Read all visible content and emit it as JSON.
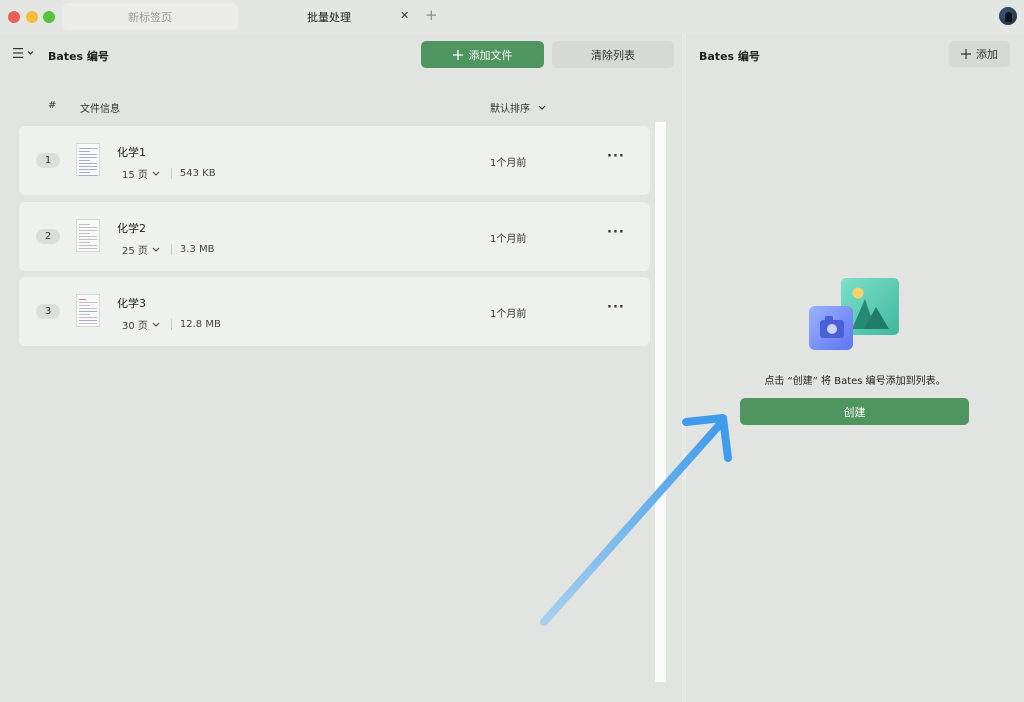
{
  "window": {
    "tabs": [
      {
        "label": "新标签页",
        "active": false
      },
      {
        "label": "批量处理",
        "active": true
      }
    ],
    "close_symbol": "✕",
    "new_tab_symbol": "+"
  },
  "left": {
    "title": "Bates 编号",
    "add_file_label": "添加文件",
    "clear_list_label": "清除列表",
    "columns": {
      "num": "#",
      "info": "文件信息",
      "sort": "默认排序"
    },
    "files": [
      {
        "index": "1",
        "name": "化学1",
        "pages": "15 页",
        "size": "543 KB",
        "date": "1个月前"
      },
      {
        "index": "2",
        "name": "化学2",
        "pages": "25 页",
        "size": "3.3 MB",
        "date": "1个月前"
      },
      {
        "index": "3",
        "name": "化学3",
        "pages": "30 页",
        "size": "12.8 MB",
        "date": "1个月前"
      }
    ],
    "more_symbol": "···"
  },
  "right": {
    "title": "Bates 编号",
    "add_label": "添加",
    "hint": "点击 “创建” 将 Bates 编号添加到列表。",
    "create_label": "创建"
  },
  "colors": {
    "accent": "#4f955f",
    "panel_bg": "#e1e4e0",
    "row_bg": "#eff1ee",
    "arrow": "#4ba3ec"
  },
  "icons": [
    "menu-icon",
    "plus-icon",
    "chevron-down-icon",
    "more-icon",
    "close-icon",
    "image-illustration-icon",
    "arrow-icon"
  ]
}
